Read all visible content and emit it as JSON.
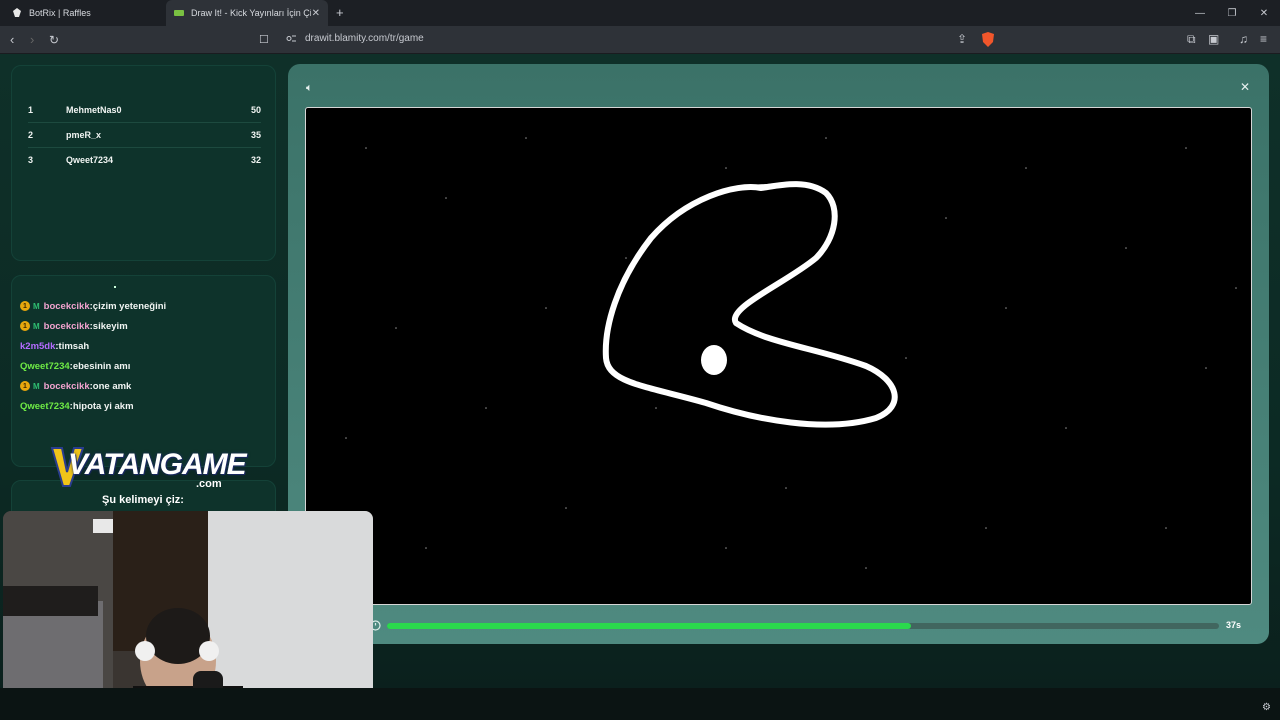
{
  "browser": {
    "tabs": [
      {
        "title": "BotRix | Raffles"
      },
      {
        "title": "Draw It! - Kick Yayınları İçin Çizim"
      }
    ],
    "url": "drawit.blamity.com/tr/game"
  },
  "leaderboard": [
    {
      "rank": "1",
      "name": "MehmetNas0",
      "score": "50"
    },
    {
      "rank": "2",
      "name": "pmeR_x",
      "score": "35"
    },
    {
      "rank": "3",
      "name": "Qweet7234",
      "score": "32"
    }
  ],
  "chat": [
    {
      "user": "bocekcikk",
      "text": ":çizim yeteneğini",
      "color": "#f2a3cf",
      "sub": "1",
      "mod": "M"
    },
    {
      "user": "bocekcikk",
      "text": ":sikeyim",
      "color": "#f2a3cf",
      "sub": "1",
      "mod": "M"
    },
    {
      "user": "k2m5dk",
      "text": ":timsah",
      "color": "#b46bff",
      "sub": "",
      "mod": ""
    },
    {
      "user": "Qweet7234",
      "text": ":ebesinin amı",
      "color": "#6eea45",
      "sub": "",
      "mod": ""
    },
    {
      "user": "bocekcikk",
      "text": ":one amk",
      "color": "#f2a3cf",
      "sub": "1",
      "mod": "M"
    },
    {
      "user": "Qweet7234",
      "text": ":hipota yi akm",
      "color": "#6eea45",
      "sub": "",
      "mod": ""
    }
  ],
  "sponsor": {
    "logo_main": "VATANGAME",
    "logo_sub": ".com"
  },
  "word_prompt": "Şu kelimeyi çiz:",
  "game": {
    "timer_text": "37s",
    "timer_fraction": 0.63
  }
}
